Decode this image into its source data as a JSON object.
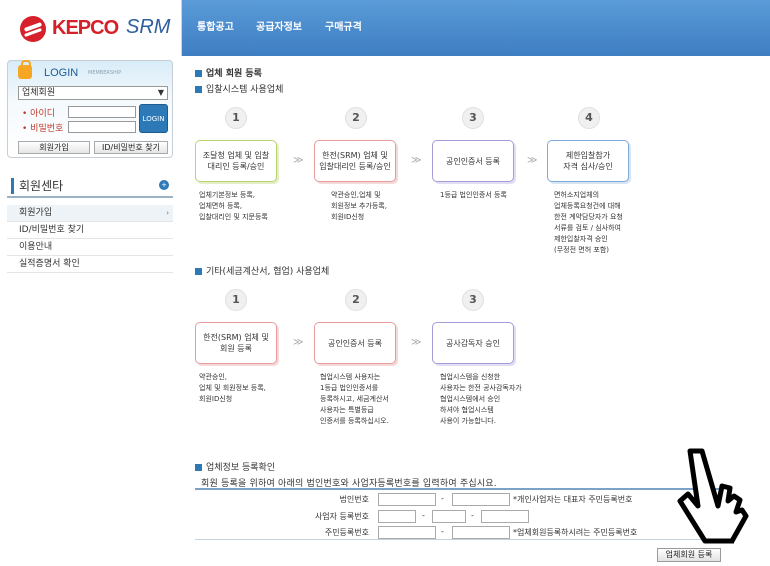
{
  "header": {
    "logo": "KEPCO SRM",
    "menu": [
      "통합공고",
      "공급자정보",
      "구매규격"
    ]
  },
  "login": {
    "title": "LOGIN",
    "subtitle": "MEMBERSHIP",
    "member_type": "업체회원",
    "id_label": "• 아이디",
    "pw_label": "• 비밀번호",
    "login_button": "LOGIN",
    "join_button": "회원가입",
    "find_button": "ID/비밀번호 찾기"
  },
  "member_center": {
    "title": "회원센타",
    "items": [
      "회원가입",
      "ID/비밀번호 찾기",
      "이용안내",
      "실적증명서 확인"
    ]
  },
  "main": {
    "title": "업체 회원 등록",
    "section1": {
      "title": "입찰시스템 사용업체",
      "steps": [
        {
          "num": "1",
          "label": "조달청 업체 및 입찰\n대리인 등록/승인",
          "desc": "업체기본정보 등록,\n업체면허 등록,\n입찰대리인 및 지문등록"
        },
        {
          "num": "2",
          "label": "한전(SRM) 업체 및\n입찰대리인 등록/승인",
          "desc": "약관승인,업체 및\n회원정보 추가등록,\n회원ID신청"
        },
        {
          "num": "3",
          "label": "공인인증서 등록",
          "desc": "1등급 법인인증서 등록"
        },
        {
          "num": "4",
          "label": "제한입찰참가\n자격 심사/승인",
          "desc": "면허소지업체의\n업체등록요청건에 대해\n한전 계약담당자가 요청\n서류를 검토 / 심사하여\n제한입찰자격 승인\n(무정전 면허 포함)"
        }
      ]
    },
    "section2": {
      "title": "기타(세금계산서, 협업) 사용업체",
      "steps": [
        {
          "num": "1",
          "label": "한전(SRM) 업체 및\n회원 등록",
          "desc": "약관승인,\n업체 및 회원정보 등록,\n회원ID신청"
        },
        {
          "num": "2",
          "label": "공인인증서 등록",
          "desc": "협업시스템 사용자는\n1등급 법인인증서를\n등록하시고, 세금계산서\n사용자는 특별등급\n인증서를 등록하십시오."
        },
        {
          "num": "3",
          "label": "공사감독자 승인",
          "desc": "협업시스템을 신청한\n사용자는 한전 공사감독자가\n협업시스템에서 승인\n하셔야 협업시스템\n사용이 가능합니다."
        }
      ]
    },
    "section3": {
      "title": "업체정보 등록확인",
      "message": "회원 등록을 위하여 아래의 법인번호와 사업자등록번호를 입력하여 주십시요.",
      "rows": [
        {
          "label": "법인번호",
          "note": "*개인사업자는 대표자 주민등록번호"
        },
        {
          "label": "사업자 등록번호",
          "note": ""
        },
        {
          "label": "주민등록번호",
          "note": "*업체회원등록하시려는 주민등록번호"
        }
      ],
      "dash": "-",
      "button": "업체회원 등록"
    }
  },
  "separator": "≫"
}
